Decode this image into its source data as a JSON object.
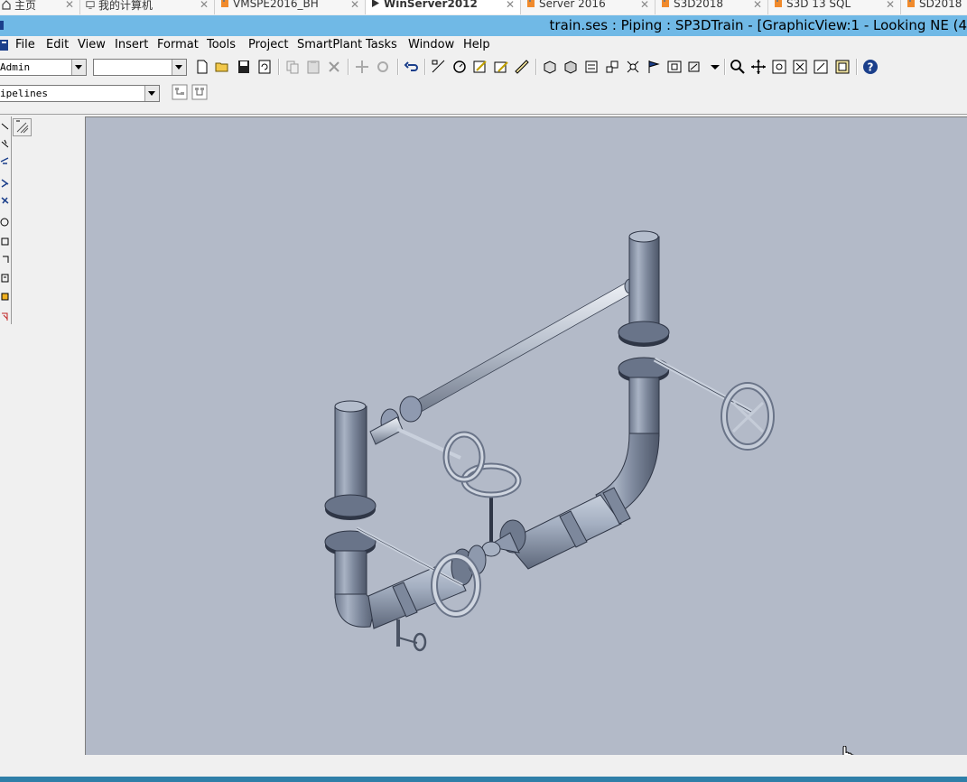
{
  "host_tabs": [
    {
      "label": "主页",
      "icon": "home-icon",
      "active": false
    },
    {
      "label": "我的计算机",
      "icon": "computer-icon",
      "active": false
    },
    {
      "label": "VMSPE2016_BH",
      "icon": "vm-icon",
      "active": false
    },
    {
      "label": "WinServer2012",
      "icon": "vm-running-icon",
      "active": true
    },
    {
      "label": "Server 2016",
      "icon": "vm-icon",
      "active": false
    },
    {
      "label": "S3D2018",
      "icon": "vm-icon",
      "active": false
    },
    {
      "label": "S3D 13 SQL",
      "icon": "vm-icon",
      "active": false
    },
    {
      "label": "SD2018",
      "icon": "vm-icon",
      "active": false
    }
  ],
  "title": "train.ses : Piping : SP3DTrain - [GraphicView:1 - Looking NE (4",
  "menu": [
    "File",
    "Edit",
    "View",
    "Insert",
    "Format",
    "Tools",
    "Project",
    "SmartPlant",
    "Tasks",
    "Window",
    "Help"
  ],
  "toolbar": {
    "permission_group": "Admin",
    "active_layer": "",
    "filter_value": "ipelines"
  },
  "colors": {
    "title_bar": "#70b9e6",
    "graphic_background": "#b3bac8",
    "pipe_body": "#8c97ab",
    "taskbar": "#2f7fa8"
  }
}
